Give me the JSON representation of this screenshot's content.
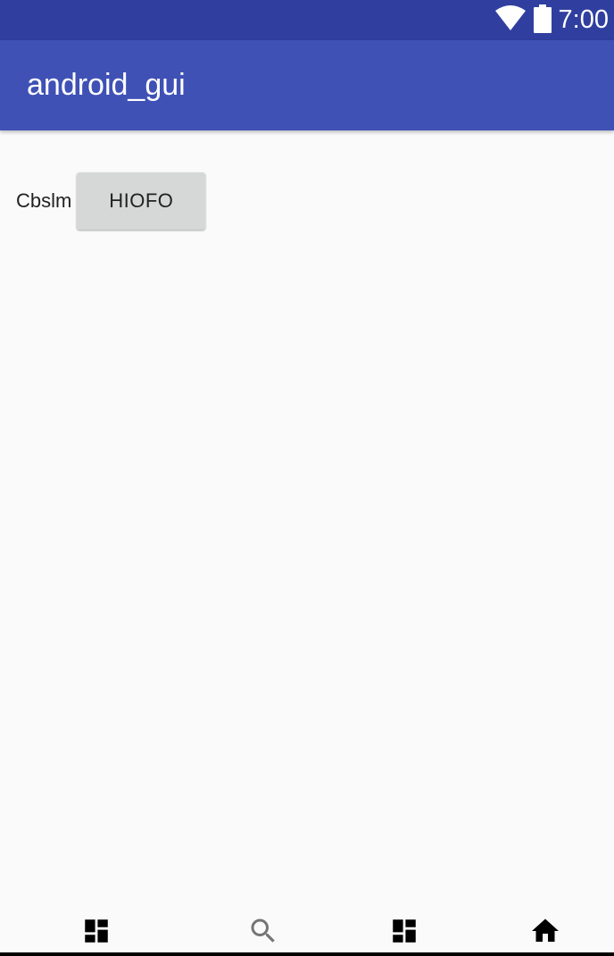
{
  "status_bar": {
    "time": "7:00",
    "icons": [
      "wifi-icon",
      "battery-icon"
    ]
  },
  "app_bar": {
    "title": "android_gui"
  },
  "main": {
    "label": "Cbslm",
    "button_label": "HIOFO"
  },
  "bottom_nav": {
    "items": [
      {
        "icon": "dashboard-icon",
        "color": "#000000"
      },
      {
        "icon": "search-icon",
        "color": "#757575"
      },
      {
        "icon": "dashboard-icon",
        "color": "#000000"
      },
      {
        "icon": "home-icon",
        "color": "#000000"
      }
    ]
  },
  "colors": {
    "status_bar": "#303f9f",
    "primary": "#3f51b5",
    "background": "#fafafa",
    "button": "#d6d7d7"
  }
}
